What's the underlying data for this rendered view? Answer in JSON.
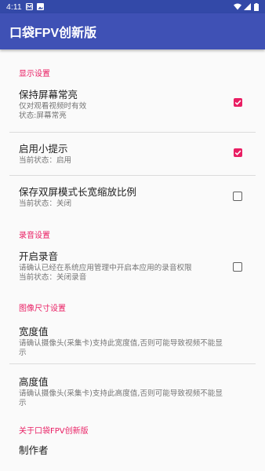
{
  "status_bar": {
    "time": "4:11"
  },
  "app_bar": {
    "title": "口袋FPV创新版"
  },
  "categories": {
    "display": "显示设置",
    "audio": "录音设置",
    "image": "图像尺寸设置",
    "about": "关于口袋FPV创新版"
  },
  "prefs": {
    "keep_screen": {
      "title": "保持屏幕常亮",
      "summary_line1": "仅对观看视频时有效",
      "summary_line2": "状态:屏幕常亮",
      "checked": true
    },
    "tips": {
      "title": "启用小提示",
      "summary": "当前状态：启用",
      "checked": true
    },
    "dual_ratio": {
      "title": "保存双屏模式长宽缩放比例",
      "summary": "当前状态：关闭",
      "checked": false
    },
    "recording": {
      "title": "开启录音",
      "summary_line1": "请确认已经在系统应用管理中开启本应用的录音权限",
      "summary_line2": "当前状态：关闭录音",
      "checked": false
    },
    "width": {
      "title": "宽度值",
      "summary_line1": "请确认摄像头(采集卡)支持此宽度值,否则可能导致视频不能显",
      "summary_line2": "示"
    },
    "height": {
      "title": "高度值",
      "summary_line1": "请确认摄像头(采集卡)支持此高度值,否则可能导致视频不能显",
      "summary_line2": "示"
    },
    "author": {
      "title": "制作者"
    }
  },
  "colors": {
    "status_bar": "#3349a8",
    "app_bar": "#3f51b5",
    "accent": "#e91e63"
  }
}
